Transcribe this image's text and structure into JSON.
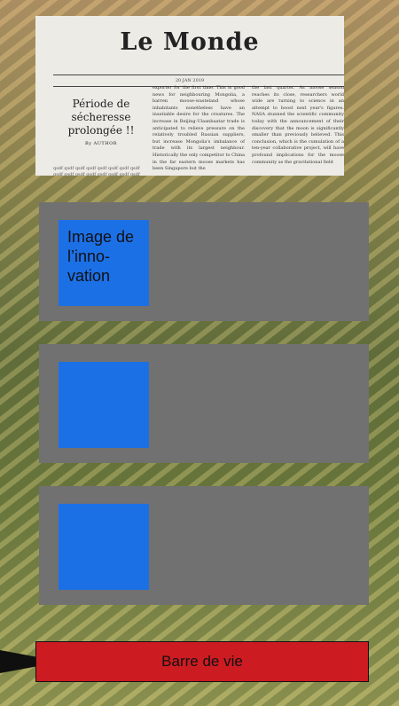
{
  "newspaper": {
    "masthead": "Le Monde",
    "date": "20 JAN 2019",
    "headline": "Période de sécheresse prolongée !!",
    "byline": "By AUTHOR",
    "filler": "qsdf qsdf qsdf qsdf qsdf qsdf qsdf qsdf qsdf qsdf qsdf qsdf qsdf qsdf qsdf qsdf qsdf qsdf qsdf qsdf",
    "column2": "exporter for the first time. This is good news for neighbouring Mongolia, a barren moose-wasteland whose inhabitants nonetheless have an insatiable desire for the creatures. The increase in Beijing-Ulaanbaatar trade is anticipated to relieve pressure on the relatively troubled Russian suppliers, but increase Mongolia's imbalance of trade with its largest neighbour. Historically the only competitor to China in the far eastern moose markets has been Singapore but the",
    "column3": "the last quarter. As moose season reaches its close, researchers world wide are turning to science in an attempt to boost next year's figures. NASA stunned the scientific community today with the announcement of their discovery that the moon is significantly smaller than previously believed. This conclusion, which is the cumulation of a ten-year collaborative project, will have profound implications for the moose community as the gravitational field"
  },
  "cards": [
    {
      "thumb_label": "Image de l’inno-vation"
    },
    {
      "thumb_label": ""
    },
    {
      "thumb_label": ""
    }
  ],
  "health_bar": {
    "label": "Barre de vie"
  },
  "colors": {
    "card": "#717171",
    "thumb": "#1c70e6",
    "health_bar": "#cc1c22"
  }
}
